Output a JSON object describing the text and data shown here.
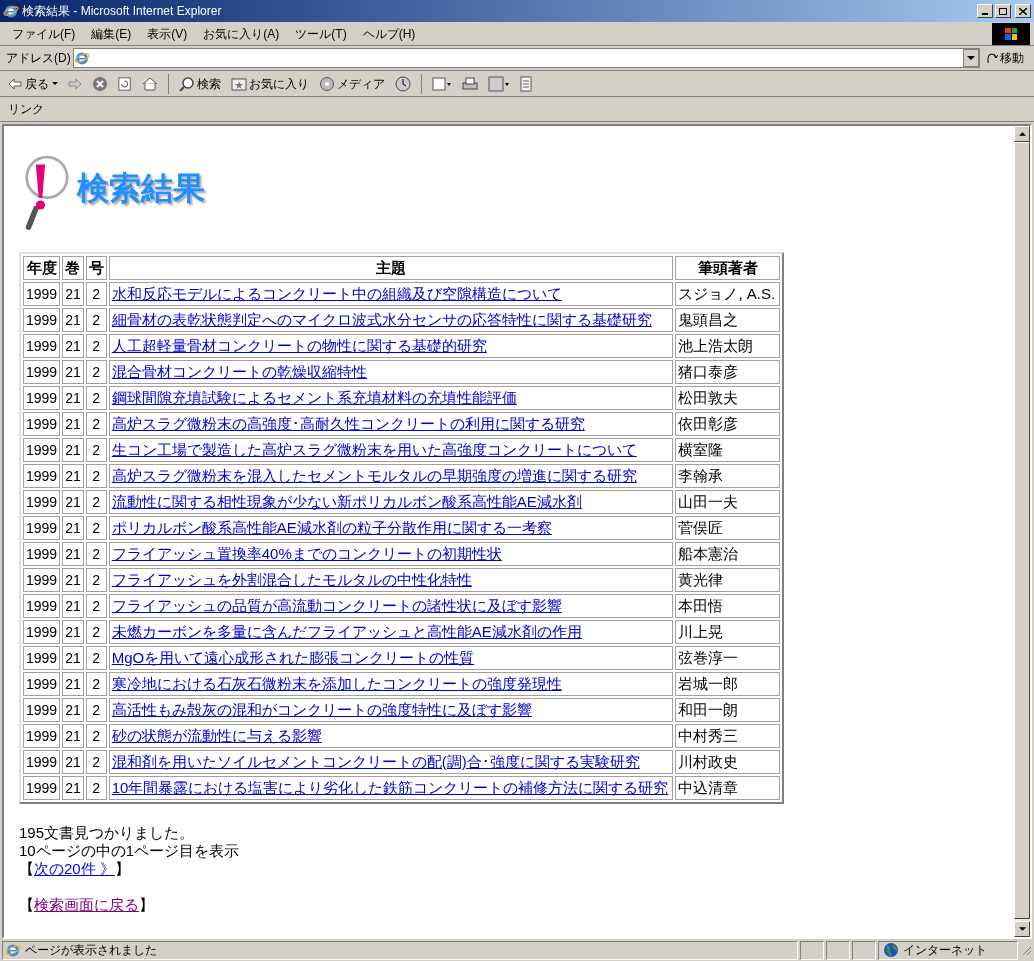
{
  "window": {
    "title": "検索結果 - Microsoft Internet Explorer"
  },
  "menu": [
    "ファイル(F)",
    "編集(E)",
    "表示(V)",
    "お気に入り(A)",
    "ツール(T)",
    "ヘルプ(H)"
  ],
  "address_bar": {
    "label": "アドレス(D)",
    "go": "移動"
  },
  "toolbar": {
    "back": "戻る",
    "search": "検索",
    "favorites": "お気に入り",
    "media": "メディア"
  },
  "links_bar": {
    "label": "リンク"
  },
  "page": {
    "heading": "検索結果",
    "table": {
      "columns": [
        "年度",
        "巻",
        "号",
        "主題",
        "筆頭著者"
      ],
      "rows": [
        {
          "year": "1999",
          "volume": "21",
          "number": "2",
          "title": "水和反応モデルによるコンクリート中の組織及び空隙構造について",
          "author": "スジョノ, A.S.",
          "visited": false
        },
        {
          "year": "1999",
          "volume": "21",
          "number": "2",
          "title": "細骨材の表乾状態判定へのマイクロ波式水分センサの応答特性に関する基礎研究",
          "author": "鬼頭昌之",
          "visited": false
        },
        {
          "year": "1999",
          "volume": "21",
          "number": "2",
          "title": "人工超軽量骨材コンクリートの物性に関する基礎的研究",
          "author": "池上浩太朗",
          "visited": false
        },
        {
          "year": "1999",
          "volume": "21",
          "number": "2",
          "title": "混合骨材コンクリートの乾燥収縮特性",
          "author": "猪口泰彦",
          "visited": false
        },
        {
          "year": "1999",
          "volume": "21",
          "number": "2",
          "title": "鋼球間隙充填試験によるセメント系充填材料の充填性能評価",
          "author": "松田敦夫",
          "visited": false
        },
        {
          "year": "1999",
          "volume": "21",
          "number": "2",
          "title": "高炉スラグ微粉末の高強度･高耐久性コンクリートの利用に関する研究",
          "author": "依田彰彦",
          "visited": false
        },
        {
          "year": "1999",
          "volume": "21",
          "number": "2",
          "title": "生コン工場で製造した高炉スラグ微粉末を用いた高強度コンクリートについて",
          "author": "横室隆",
          "visited": false
        },
        {
          "year": "1999",
          "volume": "21",
          "number": "2",
          "title": "高炉スラグ微粉末を混入したセメントモルタルの早期強度の増進に関する研究",
          "author": "李翰承",
          "visited": false
        },
        {
          "year": "1999",
          "volume": "21",
          "number": "2",
          "title": "流動性に関する相性現象が少ない新ポリカルボン酸系高性能AE減水剤",
          "author": "山田一夫",
          "visited": false
        },
        {
          "year": "1999",
          "volume": "21",
          "number": "2",
          "title": "ポリカルボン酸系高性能AE減水剤の粒子分散作用に関する一考察",
          "author": "菅俣匠",
          "visited": false
        },
        {
          "year": "1999",
          "volume": "21",
          "number": "2",
          "title": "フライアッシュ置換率40%までのコンクリートの初期性状",
          "author": "船本憲治",
          "visited": false
        },
        {
          "year": "1999",
          "volume": "21",
          "number": "2",
          "title": "フライアッシュを外割混合したモルタルの中性化特性",
          "author": "黄光律",
          "visited": false
        },
        {
          "year": "1999",
          "volume": "21",
          "number": "2",
          "title": "フライアッシュの品質が高流動コンクリートの諸性状に及ぼす影響",
          "author": "本田悟",
          "visited": false
        },
        {
          "year": "1999",
          "volume": "21",
          "number": "2",
          "title": "未燃カーボンを多量に含んだフライアッシュと高性能AE減水剤の作用",
          "author": "川上晃",
          "visited": false
        },
        {
          "year": "1999",
          "volume": "21",
          "number": "2",
          "title": "MgOを用いて遠心成形された膨張コンクリートの性質",
          "author": "弦巻淳一",
          "visited": false
        },
        {
          "year": "1999",
          "volume": "21",
          "number": "2",
          "title": "寒冷地における石灰石微粉末を添加したコンクリートの強度発現性",
          "author": "岩城一郎",
          "visited": false
        },
        {
          "year": "1999",
          "volume": "21",
          "number": "2",
          "title": "高活性もみ殻灰の混和がコンクリートの強度特性に及ぼす影響",
          "author": "和田一朗",
          "visited": false
        },
        {
          "year": "1999",
          "volume": "21",
          "number": "2",
          "title": "砂の状態が流動性に与える影響",
          "author": "中村秀三",
          "visited": false
        },
        {
          "year": "1999",
          "volume": "21",
          "number": "2",
          "title": "混和剤を用いたソイルセメントコンクリートの配(調)合･強度に関する実験研究",
          "author": "川村政史",
          "visited": false
        },
        {
          "year": "1999",
          "volume": "21",
          "number": "2",
          "title": "10年間暴露における塩害により劣化した鉄筋コンクリートの補修方法に関する研究",
          "author": "中込清章",
          "visited": false
        }
      ]
    },
    "found_text": "195文書見つかりました。",
    "page_text": "10ページの中の1ページ目を表示",
    "next_link": {
      "open": "【",
      "label": "次の20件 》",
      "close": "】",
      "visited": false
    },
    "back_link": {
      "open": "【",
      "label": "検索画面に戻る",
      "close": "】",
      "visited": true
    }
  },
  "status_bar": {
    "message": "ページが表示されました",
    "zone": "インターネット"
  }
}
